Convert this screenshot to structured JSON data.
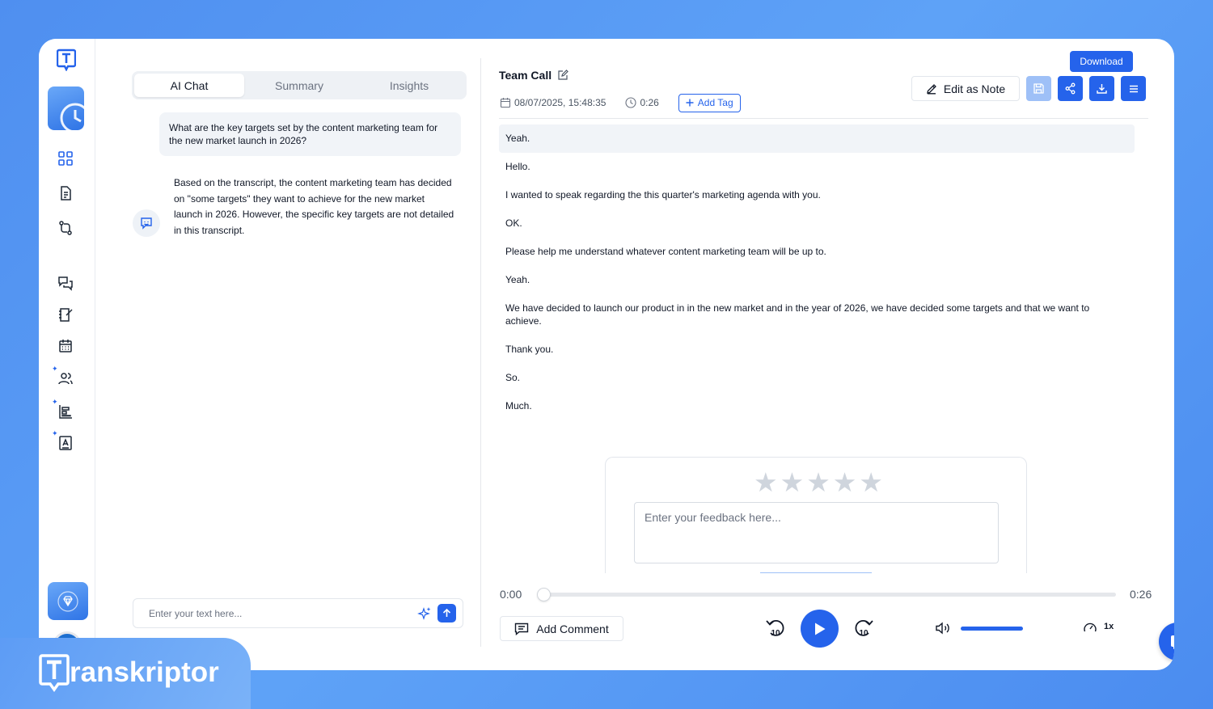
{
  "brand": {
    "name": "ranskriptor",
    "mark_letter": "T",
    "accent": "#2563eb"
  },
  "left": {
    "tabs": [
      "AI Chat",
      "Summary",
      "Insights"
    ],
    "active_tab": "AI Chat",
    "question": "What are the key targets set by the content marketing team for the new market launch in 2026?",
    "answer": "Based on the transcript, the content marketing team has decided on \"some targets\" they want to achieve for the new market launch in 2026. However, the specific key targets are not detailed in this transcript.",
    "chat_placeholder": "Enter your text here..."
  },
  "header": {
    "title": "Team Call",
    "datetime": "08/07/2025, 15:48:35",
    "duration": "0:26",
    "add_tag": "Add Tag",
    "edit_as_note": "Edit as Note",
    "download_tooltip": "Download"
  },
  "transcript": [
    "Yeah.",
    "Hello.",
    "I wanted to speak regarding the this quarter's marketing agenda with you.",
    "OK.",
    "Please help me understand whatever content marketing team will be up to.",
    "Yeah.",
    "We have decided to launch our product in in the new market and in the year of 2026, we have decided some targets and that we want to achieve.",
    "Thank you.",
    "So.",
    "Much."
  ],
  "feedback": {
    "placeholder": "Enter your feedback here...",
    "rating": 0,
    "max_rating": 5
  },
  "player": {
    "current_time": "0:00",
    "total_time": "0:26",
    "progress": 0,
    "add_comment": "Add Comment",
    "skip_back": "10",
    "skip_forward": "10",
    "speed": "1x",
    "volume": 1.0
  },
  "icons": {
    "sidebar": [
      "dashboard-icon",
      "file-icon",
      "convert-icon",
      "chat-icon",
      "notebook-icon",
      "calendar-icon",
      "team-icon",
      "chart-icon",
      "contact-icon"
    ]
  }
}
